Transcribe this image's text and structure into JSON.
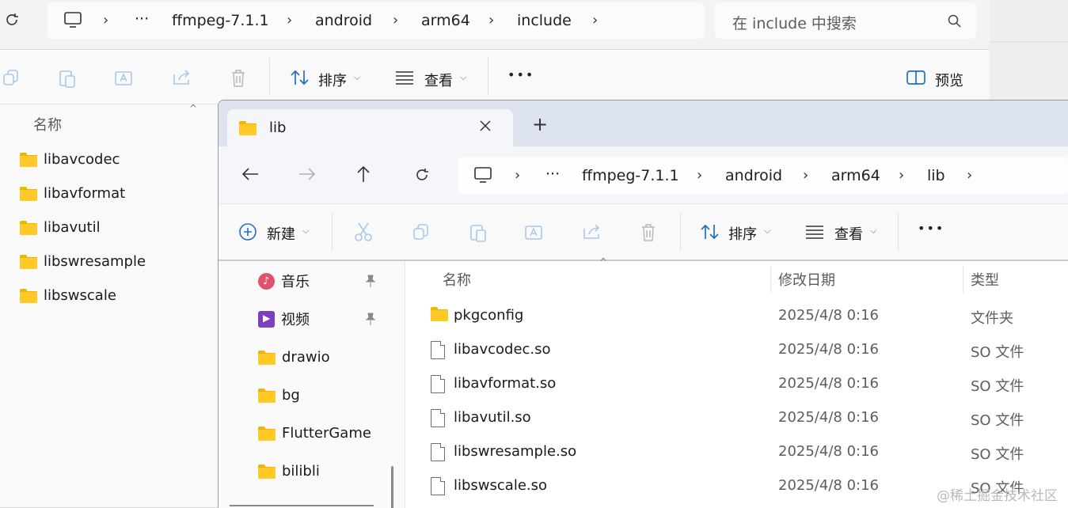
{
  "back_window": {
    "breadcrumb": [
      "ffmpeg-7.1.1",
      "android",
      "arm64",
      "include"
    ],
    "more_dots": "···",
    "search_placeholder": "在 include 中搜索",
    "toolbar": {
      "sort_label": "排序",
      "view_label": "查看",
      "more_label": "•••",
      "preview_label": "预览"
    },
    "column_name": "名称",
    "folders": [
      "libavcodec",
      "libavformat",
      "libavutil",
      "libswresample",
      "libswscale"
    ]
  },
  "front_window": {
    "tab_title": "lib",
    "new_tab_symbol": "+",
    "breadcrumb": [
      "ffmpeg-7.1.1",
      "android",
      "arm64",
      "lib"
    ],
    "more_dots": "···",
    "toolbar": {
      "new_label": "新建",
      "sort_label": "排序",
      "view_label": "查看",
      "more_label": "•••"
    },
    "nav_pane": {
      "items": [
        {
          "label": "音乐",
          "icon": "music-icon",
          "pinned": true
        },
        {
          "label": "视频",
          "icon": "video-icon",
          "pinned": true
        },
        {
          "label": "drawio",
          "icon": "folder-icon",
          "pinned": false
        },
        {
          "label": "bg",
          "icon": "folder-icon",
          "pinned": false
        },
        {
          "label": "FlutterGame",
          "icon": "folder-icon",
          "pinned": false
        },
        {
          "label": "bilibli",
          "icon": "folder-icon",
          "pinned": false
        }
      ]
    },
    "columns": {
      "name": "名称",
      "date": "修改日期",
      "type": "类型"
    },
    "files": [
      {
        "name": "pkgconfig",
        "date": "2025/4/8 0:16",
        "type": "文件夹",
        "icon": "folder-icon"
      },
      {
        "name": "libavcodec.so",
        "date": "2025/4/8 0:16",
        "type": "SO 文件",
        "icon": "file-icon"
      },
      {
        "name": "libavformat.so",
        "date": "2025/4/8 0:16",
        "type": "SO 文件",
        "icon": "file-icon"
      },
      {
        "name": "libavutil.so",
        "date": "2025/4/8 0:16",
        "type": "SO 文件",
        "icon": "file-icon"
      },
      {
        "name": "libswresample.so",
        "date": "2025/4/8 0:16",
        "type": "SO 文件",
        "icon": "file-icon"
      },
      {
        "name": "libswscale.so",
        "date": "2025/4/8 0:16",
        "type": "SO 文件",
        "icon": "file-icon"
      }
    ]
  },
  "watermark": "@稀土掘金技术社区",
  "colors": {
    "folder": "#ffc928",
    "accent_blue": "#1e6fc9",
    "tabbar": "#dde3ee"
  }
}
